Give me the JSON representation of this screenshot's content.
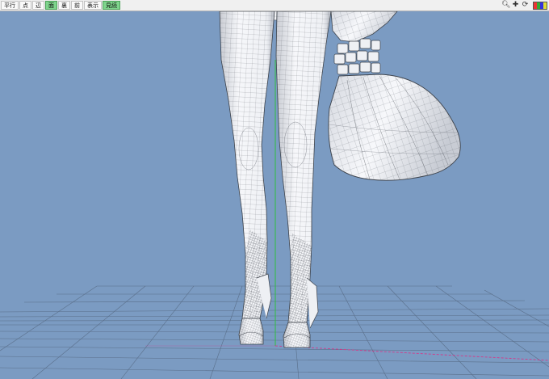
{
  "toolbar": {
    "buttons": [
      {
        "label": "平行",
        "active": false
      },
      {
        "label": "点",
        "active": false
      },
      {
        "label": "辺",
        "active": false
      },
      {
        "label": "面",
        "active": true
      },
      {
        "label": "裏",
        "active": false
      },
      {
        "label": "前",
        "active": false
      },
      {
        "label": "表示",
        "active": false
      },
      {
        "label": "見続",
        "active": true
      }
    ],
    "icons": [
      "magnifier-icon",
      "move-cross-icon",
      "rotate-icon",
      "color-swatch-icon"
    ]
  },
  "viewport": {
    "background_color": "#7b9bc2",
    "grid_color": "#5a6f8a",
    "axis_y_color": "#2fbf3f",
    "axis_x_color": "#d43a8a",
    "model_fill": "#f3f5f8",
    "wire_color": "#4a4f58"
  }
}
